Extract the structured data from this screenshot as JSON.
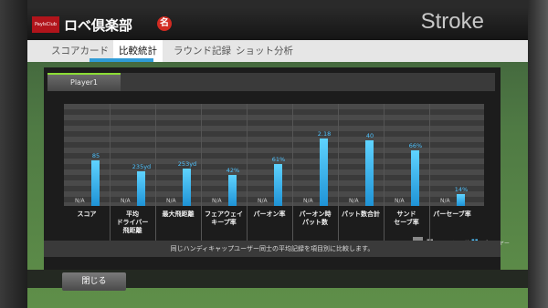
{
  "header": {
    "logo": "PaylsClub",
    "club_name": "ロベ倶楽部",
    "badge": "名",
    "mode": "Stroke"
  },
  "tabs": [
    {
      "label": "スコアカード",
      "active": false
    },
    {
      "label": "比較統計",
      "active": true
    },
    {
      "label": "ラウンド記録",
      "active": false
    },
    {
      "label": "ショット分析",
      "active": false
    }
  ],
  "player": {
    "name": "Player1"
  },
  "stats": [
    {
      "label_lines": [
        "スコア"
      ],
      "user_avg": "N/A",
      "player": "85",
      "level": 0.54
    },
    {
      "label_lines": [
        "平均",
        "ドライバー",
        "飛距離"
      ],
      "user_avg": "N/A",
      "player": "235yd",
      "level": 0.41
    },
    {
      "label_lines": [
        "最大飛距離"
      ],
      "user_avg": "N/A",
      "player": "253yd",
      "level": 0.45
    },
    {
      "label_lines": [
        "フェアウェイ",
        "キープ率"
      ],
      "user_avg": "N/A",
      "player": "42%",
      "level": 0.37
    },
    {
      "label_lines": [
        "パーオン率"
      ],
      "user_avg": "N/A",
      "player": "61%",
      "level": 0.5
    },
    {
      "label_lines": [
        "パーオン時",
        "パット数"
      ],
      "user_avg": "N/A",
      "player": "2.18",
      "level": 0.8
    },
    {
      "label_lines": [
        "パット数合計"
      ],
      "user_avg": "N/A",
      "player": "40",
      "level": 0.78
    },
    {
      "label_lines": [
        "サンド",
        "セーブ率"
      ],
      "user_avg": "N/A",
      "player": "66%",
      "level": 0.66
    },
    {
      "label_lines": [
        "パーセーブ率"
      ],
      "user_avg": "N/A",
      "player": "14%",
      "level": 0.14
    }
  ],
  "legend": {
    "user_avg": "ユーザー平均",
    "player": "プレイヤー"
  },
  "footnote": "同じハンディキャップユーザー同士の平均記録を項目別に比較します。",
  "close_label": "閉じる",
  "colors": {
    "bar": "#2fb0f0",
    "active_tab_indicator": "#2f9bd6",
    "player_tab_accent": "#8bdc35",
    "logo_red": "#b1141b"
  }
}
